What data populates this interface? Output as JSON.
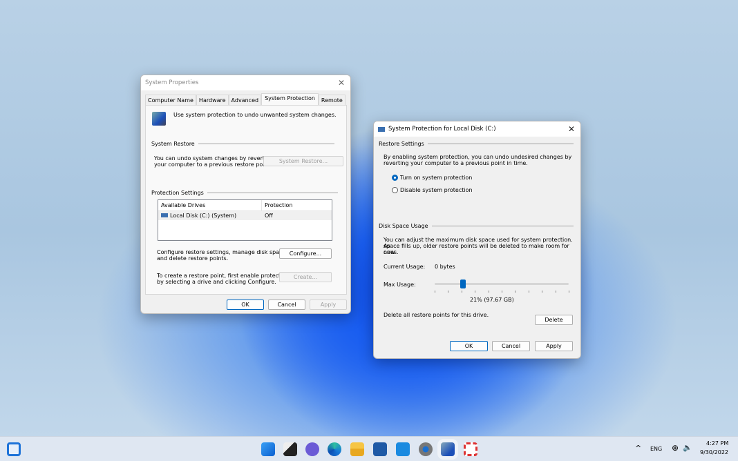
{
  "sysprops": {
    "title": "System Properties",
    "tabs": [
      "Computer Name",
      "Hardware",
      "Advanced",
      "System Protection",
      "Remote"
    ],
    "active_tab": "System Protection",
    "intro": "Use system protection to undo unwanted system changes.",
    "restore_group": "System Restore",
    "restore_text1": "You can undo system changes by reverting",
    "restore_text2": "your computer to a previous restore point.",
    "restore_button": "System Restore...",
    "protection_group": "Protection Settings",
    "col_drives": "Available Drives",
    "col_protection": "Protection",
    "drives": [
      {
        "name": "Local Disk (C:) (System)",
        "protection": "Off"
      }
    ],
    "configure_text1": "Configure restore settings, manage disk space,",
    "configure_text2": "and delete restore points.",
    "configure_button": "Configure...",
    "create_text1": "To create a restore point, first enable protection",
    "create_text2": "by selecting a drive and clicking Configure.",
    "create_button": "Create...",
    "ok": "OK",
    "cancel": "Cancel",
    "apply": "Apply"
  },
  "dialog": {
    "title": "System Protection for Local Disk (C:)",
    "restore_group": "Restore Settings",
    "restore_text1": "By enabling system protection, you can undo undesired changes by",
    "restore_text2": "reverting your computer to a previous point in time.",
    "radio_on": "Turn on system protection",
    "radio_off": "Disable system protection",
    "selected": "Turn on system protection",
    "disk_group": "Disk Space Usage",
    "disk_text1": "You can adjust the maximum disk space used for system protection. As",
    "disk_text2": "space fills up, older restore points will be deleted to make room for new",
    "disk_text3": "ones.",
    "current_label": "Current Usage:",
    "current_value": "0 bytes",
    "max_label": "Max Usage:",
    "max_percent": 21,
    "max_value": "21% (97.67 GB)",
    "delete_text": "Delete all restore points for this drive.",
    "delete_button": "Delete",
    "ok": "OK",
    "cancel": "Cancel",
    "apply": "Apply"
  },
  "taskbar": {
    "apps": [
      "start",
      "task-view",
      "teams-chat",
      "edge",
      "file-explorer",
      "store",
      "mail",
      "settings",
      "system-properties",
      "snipping-tool"
    ],
    "lang": "ENG",
    "time": "4:27 PM",
    "date": "9/30/2022"
  }
}
